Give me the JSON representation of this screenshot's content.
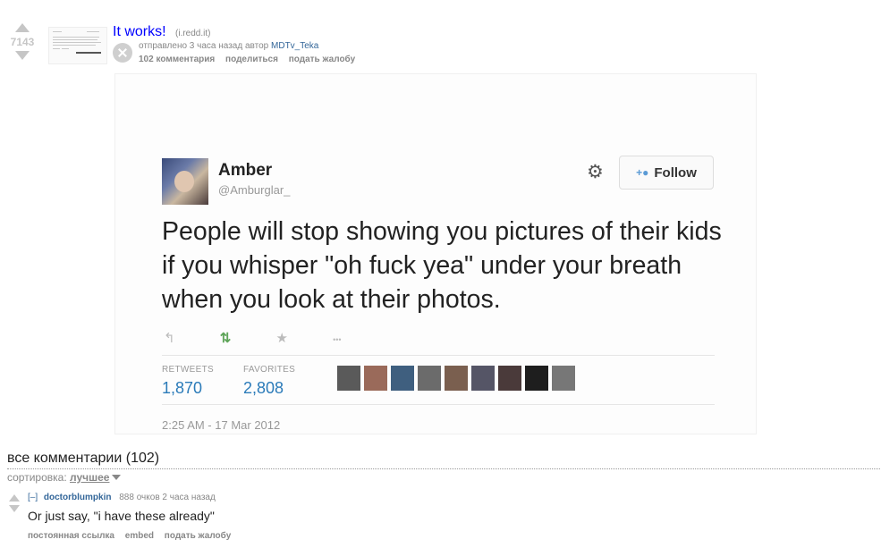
{
  "post": {
    "score": "7143",
    "title": "It works!",
    "domain": "(i.redd.it)",
    "submitted_prefix": "отправлено 3 часа назад автор",
    "author": "MDTv_Teka",
    "buttons": {
      "comments": "102 комментария",
      "share": "поделиться",
      "report": "подать жалобу"
    }
  },
  "tweet": {
    "name": "Amber",
    "handle": "@Amburglar_",
    "follow_label": "Follow",
    "text": "People will stop showing you pictures of their kids if you whisper \"oh fuck yea\" under your breath when you look at their photos.",
    "actions": {
      "reply": "↰",
      "retweet": "⇅",
      "favorite": "★",
      "more": "•••"
    },
    "retweets_label": "RETWEETS",
    "retweets": "1,870",
    "favorites_label": "FAVORITES",
    "favorites": "2,808",
    "timestamp": "2:25 AM - 17 Mar 2012"
  },
  "comments": {
    "header": "все комментарии (102)",
    "sort_label": "сортировка:",
    "sort_value": "лучшее",
    "items": [
      {
        "toggle": "[–]",
        "author": "doctorblumpkin",
        "meta": "888 очков 2 часа назад",
        "body": "Or just say, \"i have these already\"",
        "buttons": {
          "permalink": "постоянная ссылка",
          "embed": "embed",
          "report": "подать жалобу"
        }
      }
    ]
  },
  "colors": {
    "title_link": "#0000ff",
    "author_link": "#336699",
    "tweet_link": "#2b7bb9",
    "meta_gray": "#888888"
  }
}
